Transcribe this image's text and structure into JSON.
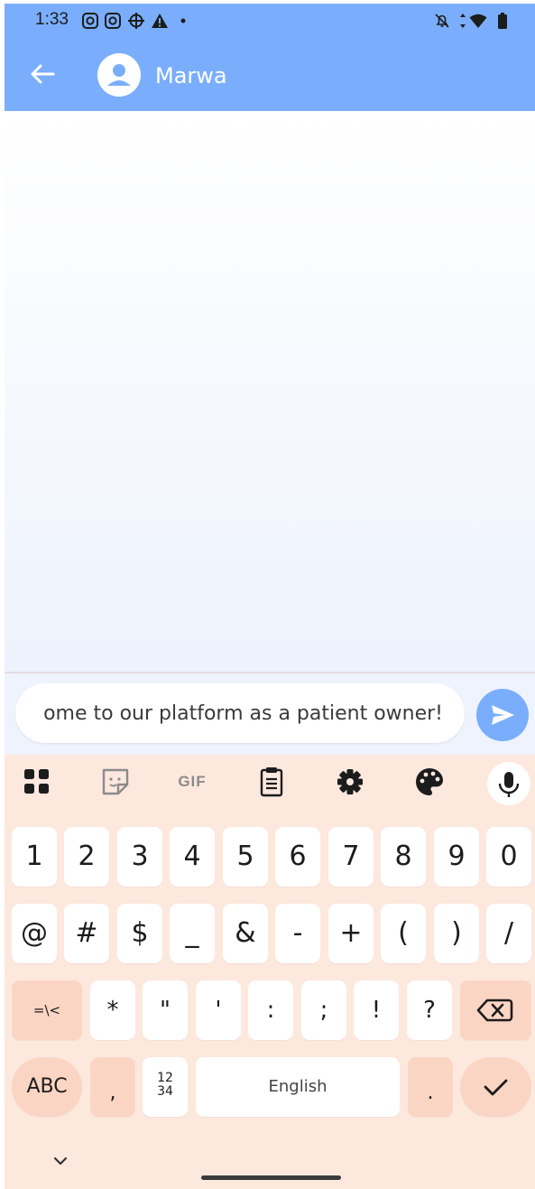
{
  "status_bar": {
    "time": "1:33"
  },
  "header": {
    "contact_name": "Marwa"
  },
  "composer": {
    "message_text": "ome to our platform as a patient owner!"
  },
  "keyboard": {
    "toolbar": [
      "apps-icon",
      "sticker-icon",
      "GIF",
      "clipboard-icon",
      "gear-icon",
      "palette-icon",
      "mic-icon"
    ],
    "gif_label": "GIF",
    "row1": [
      "1",
      "2",
      "3",
      "4",
      "5",
      "6",
      "7",
      "8",
      "9",
      "0"
    ],
    "row2": [
      "@",
      "#",
      "$",
      "_",
      "&",
      "-",
      "+",
      "(",
      ")",
      "/"
    ],
    "row3": [
      "=\\<",
      "*",
      "\"",
      "'",
      ":",
      ";",
      "!",
      "?"
    ],
    "abc_label": "ABC",
    "comma_label": ",",
    "numpad_label_top": "12",
    "numpad_label_bottom": "34",
    "space_label": "English",
    "period_label": "."
  },
  "colors": {
    "header": "#7aaefc",
    "keyboard_bg": "#fde8de",
    "key_special": "#fbd5c4"
  }
}
